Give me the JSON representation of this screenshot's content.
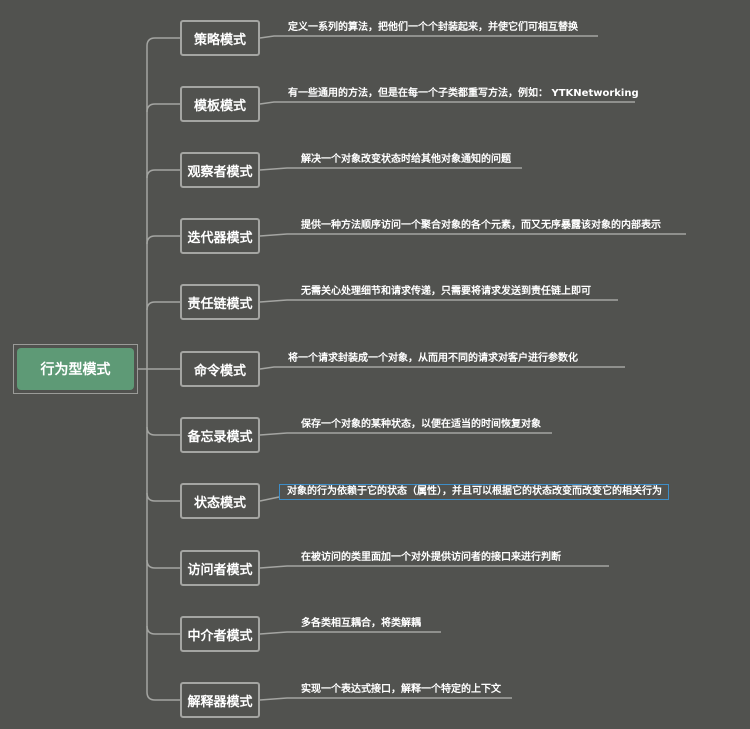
{
  "root": {
    "label": "行为型模式"
  },
  "branches": [
    {
      "label": "策略模式",
      "desc": "定义一系列的算法，把他们一个个封装起来，并使它们可相互替换"
    },
    {
      "label": "模板模式",
      "desc": "有一些通用的方法，但是在每一个子类都重写方法，例如： YTKNetworking"
    },
    {
      "label": "观察者模式",
      "desc": "解决一个对象改变状态时给其他对象通知的问题"
    },
    {
      "label": "迭代器模式",
      "desc": "提供一种方法顺序访问一个聚合对象的各个元素，而又无序暴露该对象的内部表示"
    },
    {
      "label": "责任链模式",
      "desc": "无需关心处理细节和请求传递，只需要将请求发送到责任链上即可"
    },
    {
      "label": "命令模式",
      "desc": "将一个请求封装成一个对象，从而用不同的请求对客户进行参数化"
    },
    {
      "label": "备忘录模式",
      "desc": "保存一个对象的某种状态，以便在适当的时间恢复对象"
    },
    {
      "label": "状态模式",
      "desc": "对象的行为依赖于它的状态（属性），并且可以根据它的状态改变而改变它的相关行为"
    },
    {
      "label": "访问者模式",
      "desc": "在被访问的类里面加一个对外提供访问者的接口来进行判断"
    },
    {
      "label": "中介者模式",
      "desc": "多各类相互耦合，将类解耦"
    },
    {
      "label": "解释器模式",
      "desc": "实现一个表达式接口，解释一个特定的上下文"
    }
  ],
  "colors": {
    "background": "#51524f",
    "root_fill": "#5e9a76",
    "node_border": "#a4a5a2",
    "connector": "#a4a5a2",
    "selection": "#3d8ec9"
  }
}
